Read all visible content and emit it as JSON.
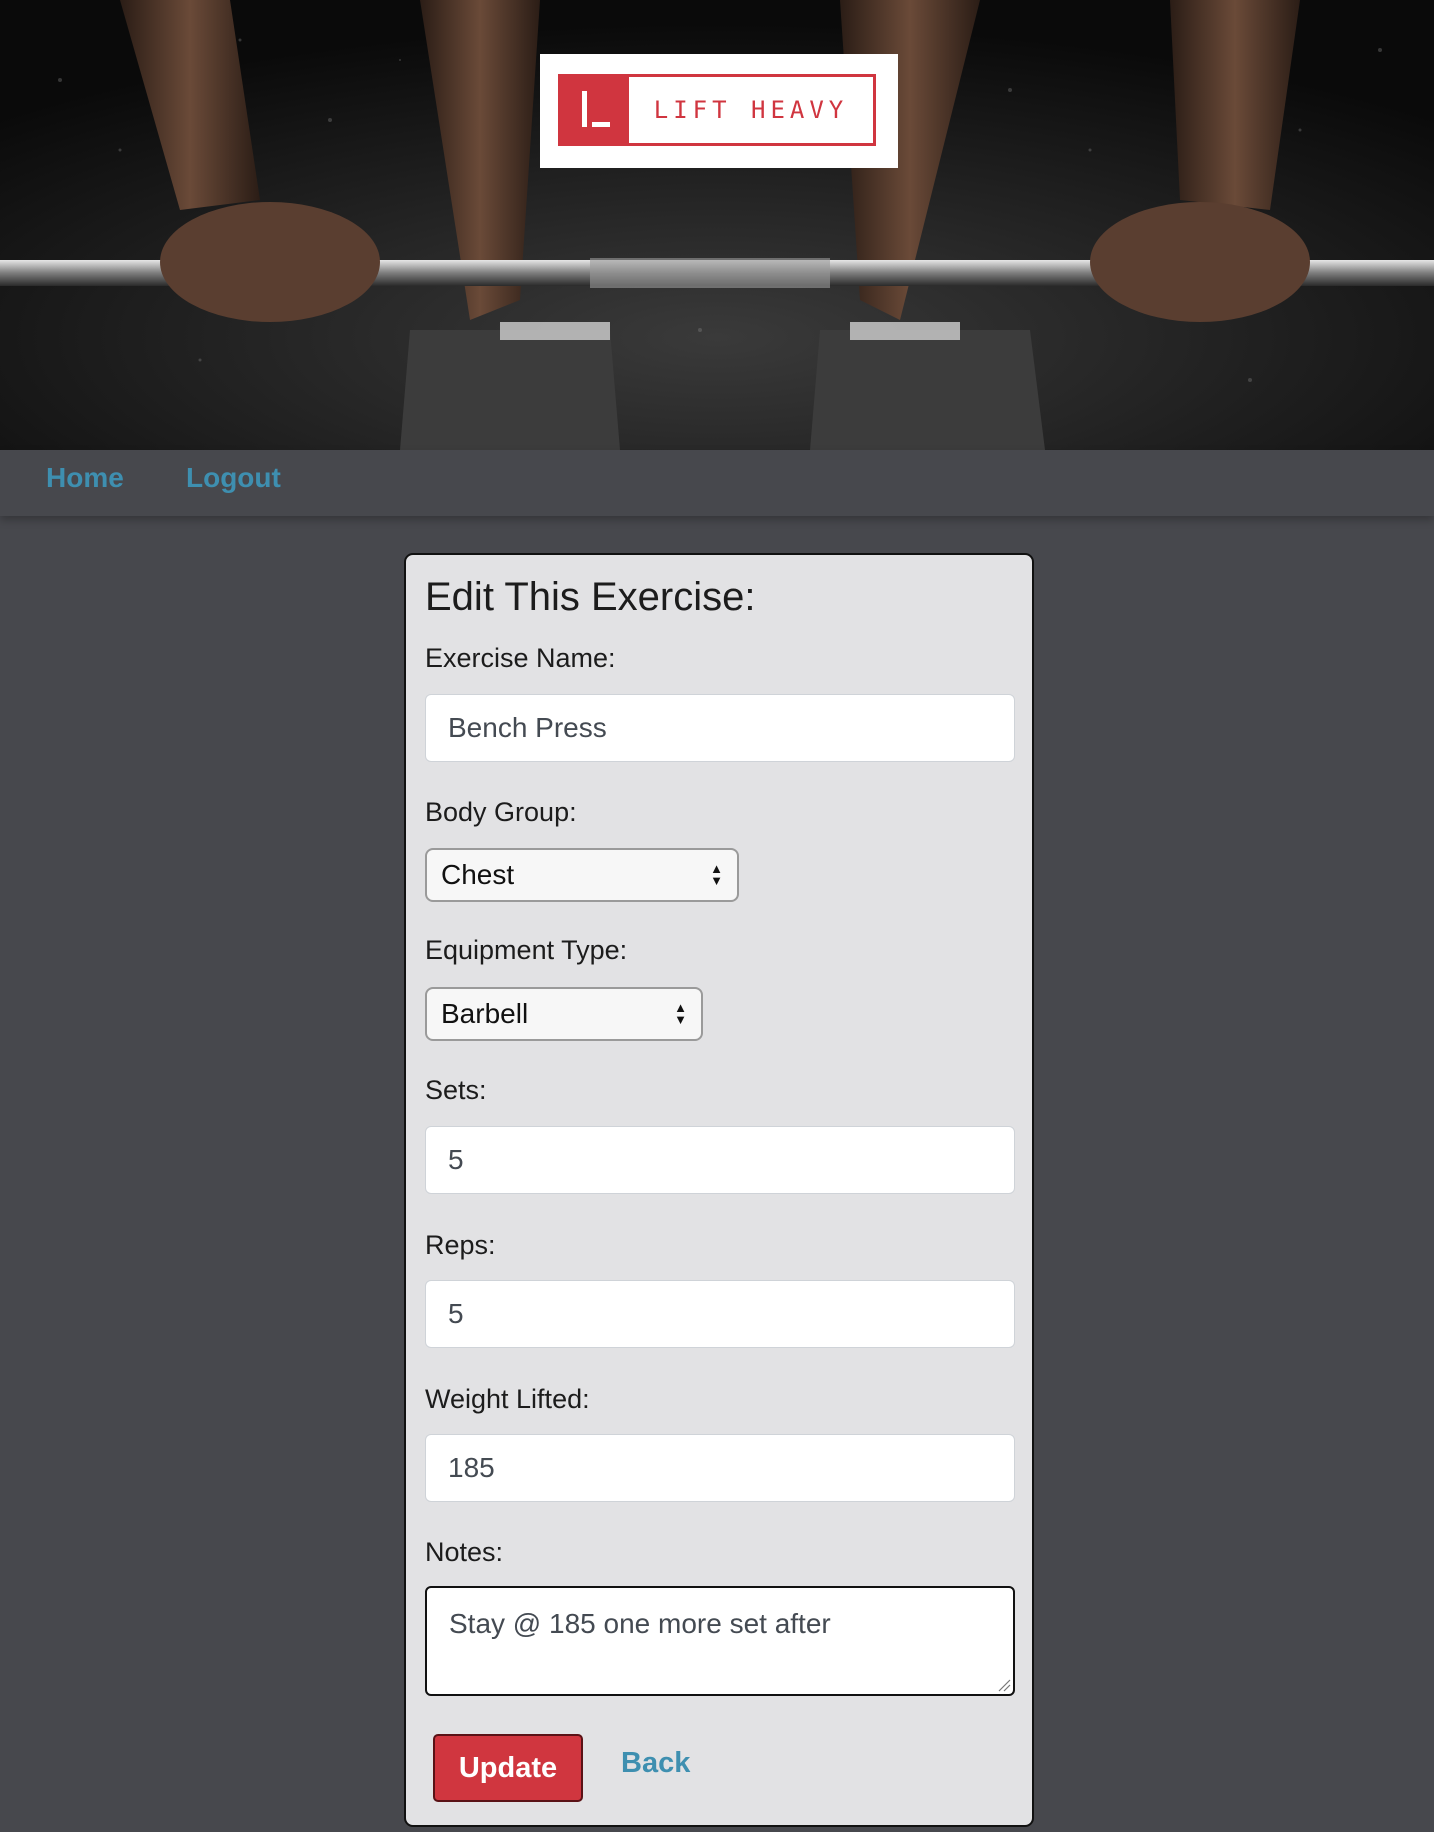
{
  "header": {
    "logo_text": "LIFT HEAVY"
  },
  "nav": {
    "home": "Home",
    "logout": "Logout"
  },
  "form": {
    "title": "Edit This Exercise:",
    "exercise_name": {
      "label": "Exercise Name:",
      "value": "Bench Press"
    },
    "body_group": {
      "label": "Body Group:",
      "value": "Chest"
    },
    "equipment_type": {
      "label": "Equipment Type:",
      "value": "Barbell"
    },
    "sets": {
      "label": "Sets:",
      "value": "5"
    },
    "reps": {
      "label": "Reps:",
      "value": "5"
    },
    "weight_lifted": {
      "label": "Weight Lifted:",
      "value": "185"
    },
    "notes": {
      "label": "Notes:",
      "value": "Stay @ 185 one more set after"
    },
    "update_label": "Update",
    "back_label": "Back"
  },
  "colors": {
    "brand_red": "#d0363f",
    "link_blue": "#3e8fb0",
    "page_bg": "#47484d",
    "card_bg": "#e2e2e4"
  }
}
